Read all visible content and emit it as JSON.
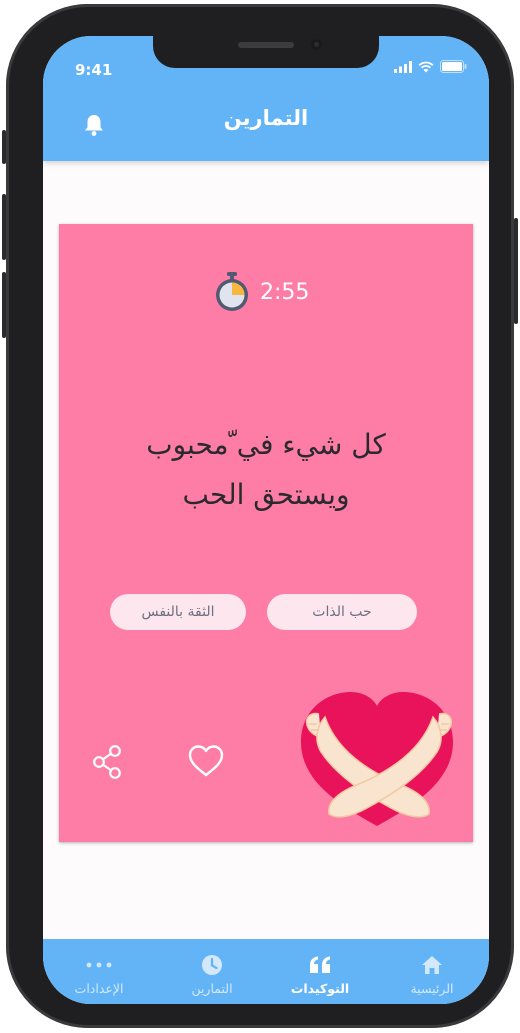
{
  "status_bar": {
    "time": "9:41"
  },
  "header": {
    "title": "التمارين"
  },
  "card": {
    "timer": "2:55",
    "quote_line1": "كل شيء في ّمحبوب",
    "quote_line2": "ويستحق الحب",
    "tags": [
      "حب الذات",
      "الثقة بالنفس"
    ]
  },
  "tabs": [
    {
      "label": "الرئيسية",
      "icon": "home-icon",
      "active": false
    },
    {
      "label": "التوكيدات",
      "icon": "quote-icon",
      "active": true
    },
    {
      "label": "التمارين",
      "icon": "clock-icon",
      "active": false
    },
    {
      "label": "الإعدادات",
      "icon": "more-icon",
      "active": false
    }
  ],
  "colors": {
    "header": "#63b4f6",
    "card": "#fd7da7",
    "chip": "#fde6ee",
    "heart": "#e8135b"
  }
}
